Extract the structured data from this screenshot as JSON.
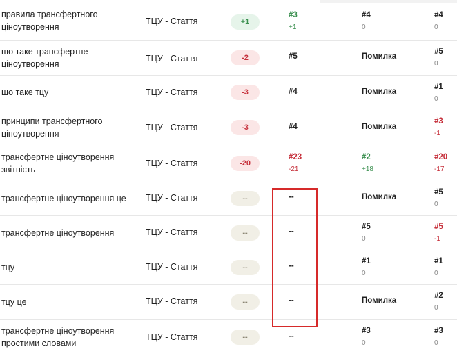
{
  "rows": [
    {
      "keyword": "правила трансфертного ціноутворення",
      "type": "ТЦУ - Стаття",
      "change": "+1",
      "rank1": "#3",
      "rank1_sub": "+1",
      "rank2": "#4",
      "rank2_sub": "0",
      "rank3": "#4",
      "rank3_sub": "0"
    },
    {
      "keyword": "що таке трансфертне ціноутворення",
      "type": "ТЦУ - Стаття",
      "change": "-2",
      "rank1": "#5",
      "rank1_sub": "",
      "rank2": "Помилка",
      "rank2_sub": "",
      "rank3": "#5",
      "rank3_sub": "0"
    },
    {
      "keyword": "що таке тцу",
      "type": "ТЦУ - Стаття",
      "change": "-3",
      "rank1": "#4",
      "rank1_sub": "",
      "rank2": "Помилка",
      "rank2_sub": "",
      "rank3": "#1",
      "rank3_sub": "0"
    },
    {
      "keyword": "принципи трансфертного ціноутворення",
      "type": "ТЦУ - Стаття",
      "change": "-3",
      "rank1": "#4",
      "rank1_sub": "",
      "rank2": "Помилка",
      "rank2_sub": "",
      "rank3": "#3",
      "rank3_sub": "-1"
    },
    {
      "keyword": "трансфертне ціноутворення звітність",
      "type": "ТЦУ - Стаття",
      "change": "-20",
      "rank1": "#23",
      "rank1_sub": "-21",
      "rank2": "#2",
      "rank2_sub": "+18",
      "rank3": "#20",
      "rank3_sub": "-17"
    },
    {
      "keyword": "трансфертне ціноутворення це",
      "type": "ТЦУ - Стаття",
      "change": "--",
      "rank1": "--",
      "rank1_sub": "",
      "rank2": "Помилка",
      "rank2_sub": "",
      "rank3": "#5",
      "rank3_sub": "0"
    },
    {
      "keyword": "трансфертне ціноутворення",
      "type": "ТЦУ - Стаття",
      "change": "--",
      "rank1": "--",
      "rank1_sub": "",
      "rank2": "#5",
      "rank2_sub": "0",
      "rank3": "#5",
      "rank3_sub": "-1"
    },
    {
      "keyword": "тцу",
      "type": "ТЦУ - Стаття",
      "change": "--",
      "rank1": "--",
      "rank1_sub": "",
      "rank2": "#1",
      "rank2_sub": "0",
      "rank3": "#1",
      "rank3_sub": "0"
    },
    {
      "keyword": "тцу це",
      "type": "ТЦУ - Стаття",
      "change": "--",
      "rank1": "--",
      "rank1_sub": "",
      "rank2": "Помилка",
      "rank2_sub": "",
      "rank3": "#2",
      "rank3_sub": "0"
    },
    {
      "keyword": "трансфертне ціноутворення простими словами",
      "type": "ТЦУ - Стаття",
      "change": "--",
      "rank1": "--",
      "rank1_sub": "",
      "rank2": "#3",
      "rank2_sub": "0",
      "rank3": "#3",
      "rank3_sub": "0"
    }
  ],
  "colors": {
    "positive": "#3a8f4f",
    "negative": "#c62f3a",
    "highlight_border": "#d62a2a"
  }
}
